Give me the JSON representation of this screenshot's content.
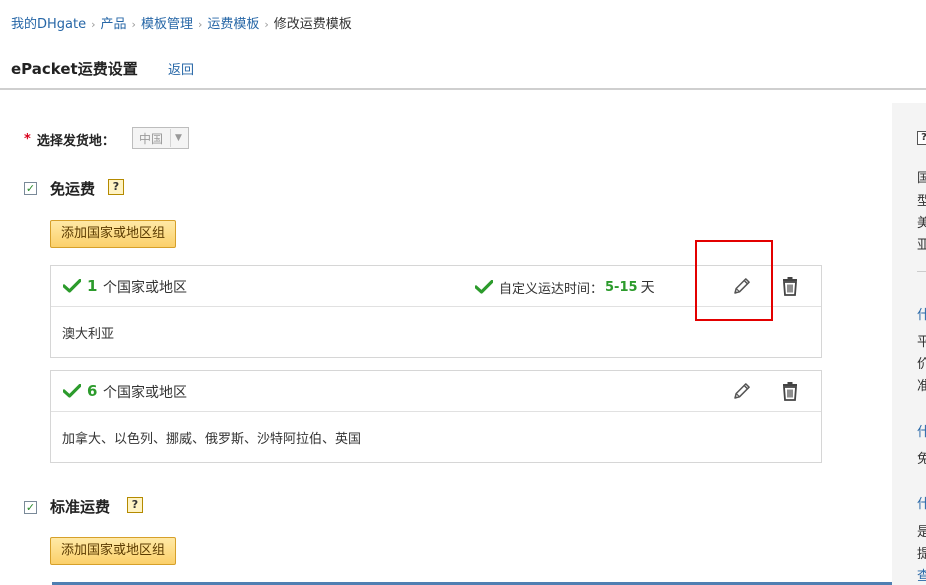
{
  "breadcrumb": {
    "items": [
      "我的DHgate",
      "产品",
      "模板管理",
      "运费模板"
    ],
    "current": "修改运费模板"
  },
  "header": {
    "title": "ePacket运费设置",
    "back_label": "返回"
  },
  "origin": {
    "label": "选择发货地：",
    "value": "中国",
    "required_mark": "*"
  },
  "free_shipping": {
    "title": "免运费",
    "checked_mark": "✓",
    "help_mark": "?",
    "add_button": "添加国家或地区组",
    "groups": [
      {
        "count": "1",
        "count_label": "个国家或地区",
        "delivery_label": "自定义运达时间：",
        "delivery_days": "5-15",
        "delivery_unit": "天",
        "countries": "澳大利亚"
      },
      {
        "count": "6",
        "count_label": "个国家或地区",
        "countries": "加拿大、以色列、挪威、俄罗斯、沙特阿拉伯、英国"
      }
    ]
  },
  "standard_shipping": {
    "title": "标准运费",
    "checked_mark": "✓",
    "help_mark": "?",
    "add_button": "添加国家或地区组"
  },
  "right_panel": {
    "help_mark": "?",
    "text_fragments": [
      "国",
      "型",
      "美",
      "亚",
      "平",
      "价",
      "准",
      "免",
      "是",
      "提"
    ],
    "link_fragments": [
      "什",
      "什",
      "什",
      "查"
    ]
  },
  "icons": {
    "check": "check-icon",
    "edit": "pencil-icon",
    "delete": "trash-icon",
    "dropdown": "chevron-down-icon"
  },
  "colors": {
    "link": "#2767a7",
    "accent_green": "#2c9b2c",
    "button_bg": "#fbd06a",
    "highlight": "#e30000"
  }
}
